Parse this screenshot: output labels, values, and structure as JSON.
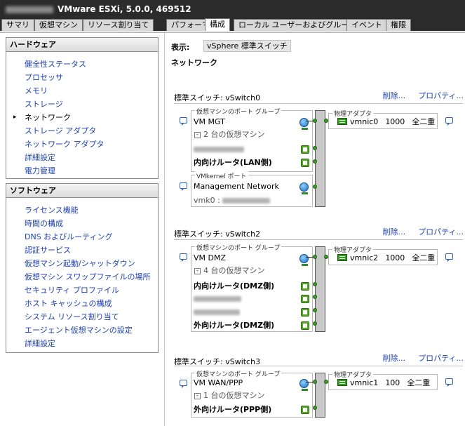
{
  "window": {
    "title": "VMware ESXi, 5.0.0, 469512"
  },
  "tabs": [
    "サマリ",
    "仮想マシン",
    "リソース割り当て",
    "パフォーマンス",
    "構成",
    "ローカル ユーザーおよびグループ",
    "イベント",
    "権限"
  ],
  "active_tab": "構成",
  "hardware": {
    "header": "ハードウェア",
    "items": [
      "健全性ステータス",
      "プロセッサ",
      "メモリ",
      "ストレージ",
      "ネットワーク",
      "ストレージ アダプタ",
      "ネットワーク アダプタ",
      "詳細設定",
      "電力管理"
    ],
    "current": "ネットワーク"
  },
  "software": {
    "header": "ソフトウェア",
    "items": [
      "ライセンス機能",
      "時間の構成",
      "DNS およびルーティング",
      "認証サービス",
      "仮想マシン起動/シャットダウン",
      "仮想マシン スワップファイルの場所",
      "セキュリティ プロファイル",
      "ホスト キャッシュの構成",
      "システム リソース割り当て",
      "エージェント仮想マシンの設定",
      "詳細設定"
    ]
  },
  "view": {
    "label": "表示:",
    "value": "vSphere 標準スイッチ"
  },
  "network_title": "ネットワーク",
  "common": {
    "remove": "削除...",
    "properties": "プロパティ...",
    "vm_portgroup_label": "仮想マシンのポート グループ",
    "vmkernel_label": "VMkernel ポート",
    "phys_label": "物理アダプタ"
  },
  "switches": [
    {
      "title": "標準スイッチ: vSwitch0",
      "portgroup": "VM MGT",
      "vm_count": "2 台の仮想マシン",
      "vms": [
        "",
        "内向けルータ(LAN側)"
      ],
      "vmkernel": {
        "name": "Management Network",
        "vmk": "vmk0 :"
      },
      "nic": {
        "name": "vmnic0",
        "speed": "1000",
        "duplex": "全二重"
      }
    },
    {
      "title": "標準スイッチ: vSwitch2",
      "portgroup": "VM DMZ",
      "vm_count": "4 台の仮想マシン",
      "vms": [
        "内向けルータ(DMZ側)",
        "",
        "",
        "外向けルータ(DMZ側)"
      ],
      "nic": {
        "name": "vmnic2",
        "speed": "1000",
        "duplex": "全二重"
      }
    },
    {
      "title": "標準スイッチ: vSwitch3",
      "portgroup": "VM WAN/PPP",
      "vm_count": "1 台の仮想マシン",
      "vms": [
        "外向けルータ(PPP側)"
      ],
      "nic": {
        "name": "vmnic1",
        "speed": "100",
        "duplex": "全二重"
      }
    }
  ]
}
